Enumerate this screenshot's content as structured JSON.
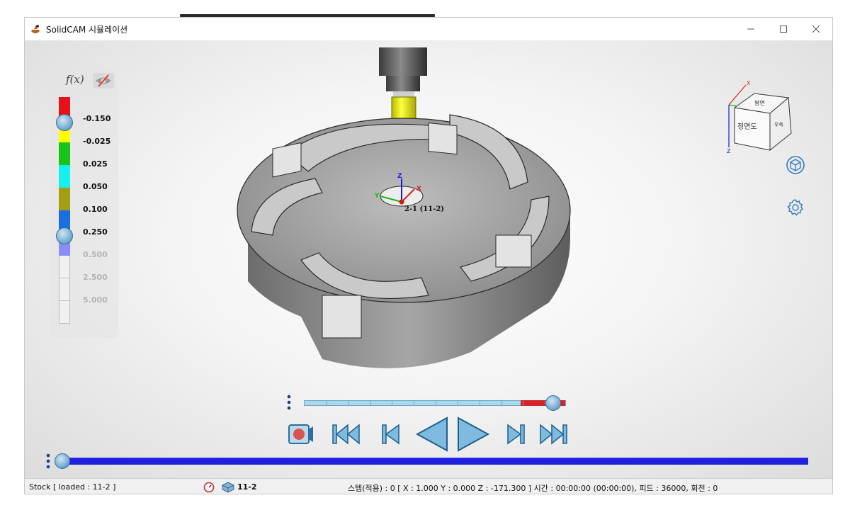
{
  "window": {
    "title": "SolidCAM 시뮬레이션"
  },
  "legend": {
    "function_label": "f(x)",
    "values": [
      {
        "label": "-0.150",
        "dim": false
      },
      {
        "label": "-0.025",
        "dim": false
      },
      {
        "label": "0.025",
        "dim": false
      },
      {
        "label": "0.050",
        "dim": false
      },
      {
        "label": "0.100",
        "dim": false
      },
      {
        "label": "0.250",
        "dim": false
      },
      {
        "label": "0.500",
        "dim": true
      },
      {
        "label": "2.500",
        "dim": true
      },
      {
        "label": "5.000",
        "dim": true
      }
    ],
    "colors": [
      "#e8111a",
      "#ffff00",
      "#18c418",
      "#16f0f0",
      "#a39d14",
      "#1a6fe0",
      "#8a8cf7"
    ]
  },
  "viewport": {
    "coord_label": "2-1 (11-2)",
    "axis": {
      "x": "X",
      "y": "Y",
      "z": "Z"
    },
    "navcube_top_text": "평면",
    "navcube_front_text": "정면도",
    "navcube_side_text": "우측"
  },
  "timeline": {
    "position": 0.95,
    "segments": 12
  },
  "progress": {
    "position": 0.0
  },
  "statusbar": {
    "stock": "Stock [ loaded : 11-2 ]",
    "operation": "11-2",
    "info": "스텝(적용) : 0 [ X : 1.000 Y : 0.000 Z : -171.300 ]  시간 : 00:00:00 (00:00:00), 피드 : 36000, 회전 : 0"
  },
  "accent": "#1f1fe0"
}
